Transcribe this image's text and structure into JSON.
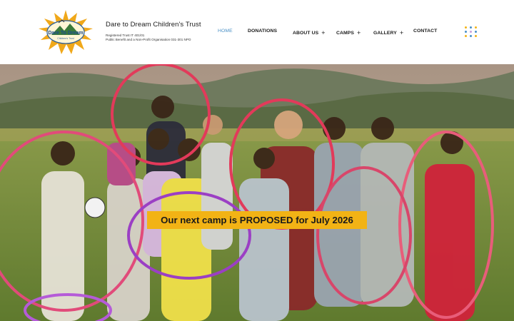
{
  "header": {
    "org_name": "Dare to Dream Children's Trust",
    "org_reg": "Registered Trust IT 401/01",
    "org_status": "Public Benefit and a Non-Profit Organisation 031-301 NPO",
    "logo_text": "Dare To Dream",
    "logo_subtext": "Children's Trust"
  },
  "nav": {
    "items": [
      {
        "label": "HOME",
        "active": true,
        "has_submenu": false
      },
      {
        "label": "DONATIONS",
        "active": false,
        "has_submenu": false
      },
      {
        "label": "ABOUT US",
        "active": false,
        "has_submenu": true
      },
      {
        "label": "CAMPS",
        "active": false,
        "has_submenu": true
      },
      {
        "label": "GALLERY",
        "active": false,
        "has_submenu": true
      },
      {
        "label": "CONTACT",
        "active": false,
        "has_submenu": false
      }
    ],
    "submenu_indicator": "+",
    "menu_icon": "grid-dots-icon"
  },
  "hero": {
    "banner_text": "Our next camp is PROPOSED for July 2026"
  },
  "colors": {
    "nav_active": "#4a90c6",
    "banner_bg": "#f2b315",
    "menu_dots": [
      "#f2b315",
      "#4a90c6",
      "#c9a0dc"
    ]
  }
}
